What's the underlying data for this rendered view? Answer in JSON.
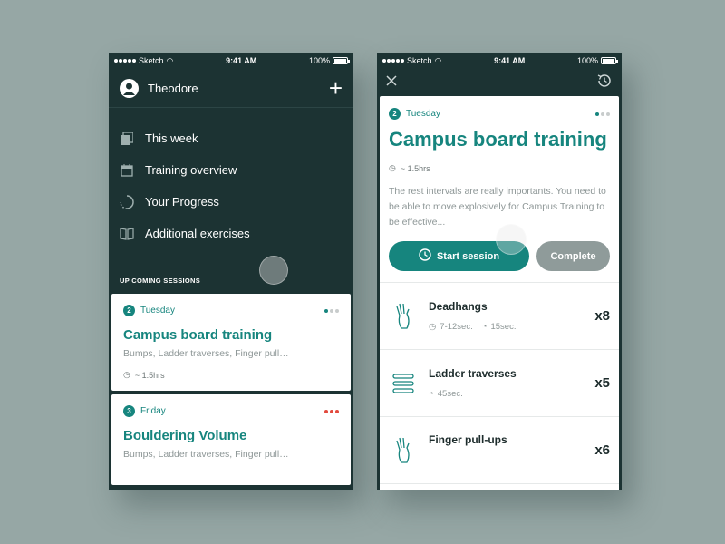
{
  "status_bar": {
    "carrier": "Sketch",
    "time": "9:41 AM",
    "battery": "100%"
  },
  "left_screen": {
    "user_name": "Theodore",
    "menu": [
      {
        "label": "This week",
        "icon": "pages-icon"
      },
      {
        "label": "Training overview",
        "icon": "calendar-icon"
      },
      {
        "label": "Your Progress",
        "icon": "progress-icon"
      },
      {
        "label": "Additional exercises",
        "icon": "book-icon"
      }
    ],
    "section_label": "UP COMING SESSIONS",
    "sessions": [
      {
        "number": "2",
        "day": "Tuesday",
        "title": "Campus board training",
        "subtitle": "Bumps, Ladder traverses, Finger pull…",
        "duration": "~ 1.5hrs",
        "status_color": "#16857e"
      },
      {
        "number": "3",
        "day": "Friday",
        "title": "Bouldering Volume",
        "subtitle": "Bumps, Ladder traverses, Finger pull…",
        "status_color": "#e2493d"
      }
    ]
  },
  "right_screen": {
    "number": "2",
    "day": "Tuesday",
    "title": "Campus board training",
    "duration": "~ 1.5hrs",
    "description": "The rest intervals are really importants. You need to be able to move explosively for Campus Training to be effective...",
    "start_label": "Start session",
    "complete_label": "Complete",
    "exercises": [
      {
        "name": "Deadhangs",
        "duration": "7-12sec.",
        "rest": "15sec.",
        "count": "x8"
      },
      {
        "name": "Ladder traverses",
        "rest": "45sec.",
        "count": "x5"
      },
      {
        "name": "Finger pull-ups",
        "count": "x6"
      }
    ]
  },
  "colors": {
    "accent": "#16857e",
    "dark_bg": "#1c3333",
    "alert": "#e2493d",
    "muted_button": "#8f9b9a"
  }
}
